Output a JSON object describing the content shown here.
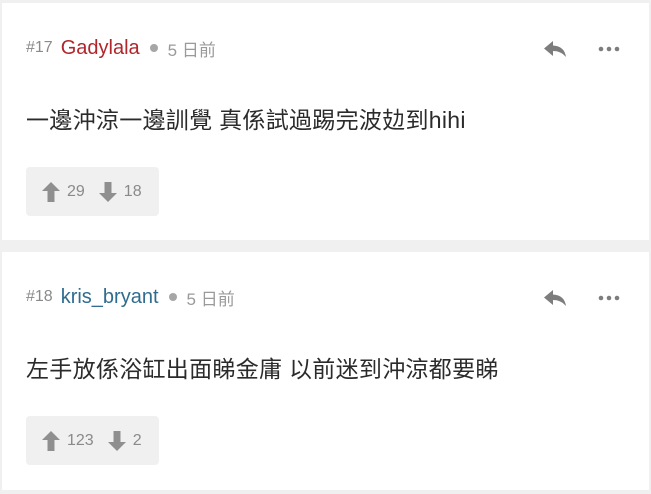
{
  "comments": [
    {
      "floor": "#17",
      "username": "Gadylala",
      "time": "5 日前",
      "content": "一邊沖涼一邊訓覺 真係試過踢完波攰到hihi",
      "upvotes": "29",
      "downvotes": "18"
    },
    {
      "floor": "#18",
      "username": "kris_bryant",
      "time": "5 日前",
      "content": "左手放係浴缸出面睇金庸 以前迷到沖涼都要睇",
      "upvotes": "123",
      "downvotes": "2"
    }
  ],
  "icons": {
    "reply": "reply-icon",
    "more": "more-icon",
    "upvote": "arrow-up-icon",
    "downvote": "arrow-down-icon"
  },
  "colors": {
    "username_1": "#b0262b",
    "username_2": "#2f6c8f",
    "background": "#f0f0f0",
    "card": "#ffffff"
  }
}
